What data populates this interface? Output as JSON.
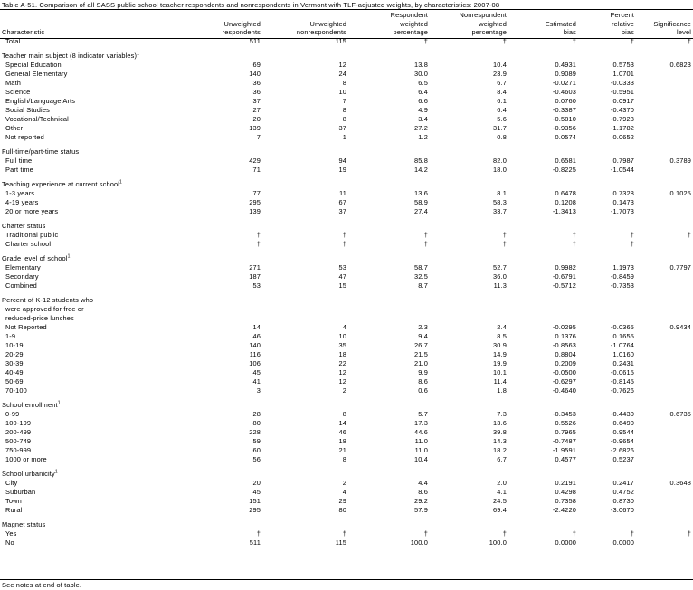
{
  "title": "Table A-51. Comparison of all SASS public school teacher respondents and nonrespondents in Vermont with TLF-adjusted weights, by characteristics: 2007-08",
  "columns": [
    [
      "Characteristic"
    ],
    [
      "Unweighted",
      "respondents"
    ],
    [
      "Unweighted",
      "nonrespondents"
    ],
    [
      "Respondent",
      "weighted",
      "percentage"
    ],
    [
      "Nonrespondent",
      "weighted",
      "percentage"
    ],
    [
      "Estimated",
      "bias"
    ],
    [
      "Percent",
      "relative",
      "bias"
    ],
    [
      "Significance",
      "level"
    ]
  ],
  "rows": [
    {
      "type": "row",
      "label": "Total",
      "indent": 1,
      "cells": [
        "511",
        "115",
        "†",
        "†",
        "†",
        "†",
        "†"
      ]
    },
    {
      "type": "gap"
    },
    {
      "type": "heading",
      "label": "Teacher main subject (8 indicator variables)",
      "sup": "1"
    },
    {
      "type": "row",
      "label": "Special Education",
      "indent": 1,
      "cells": [
        "69",
        "12",
        "13.8",
        "10.4",
        "0.4931",
        "0.5753",
        "0.6823"
      ]
    },
    {
      "type": "row",
      "label": "General Elementary",
      "indent": 1,
      "cells": [
        "140",
        "24",
        "30.0",
        "23.9",
        "0.9089",
        "1.0701",
        ""
      ]
    },
    {
      "type": "row",
      "label": "Math",
      "indent": 1,
      "cells": [
        "36",
        "8",
        "6.5",
        "6.7",
        "-0.0271",
        "-0.0333",
        ""
      ]
    },
    {
      "type": "row",
      "label": "Science",
      "indent": 1,
      "cells": [
        "36",
        "10",
        "6.4",
        "8.4",
        "-0.4603",
        "-0.5951",
        ""
      ]
    },
    {
      "type": "row",
      "label": "English/Language Arts",
      "indent": 1,
      "cells": [
        "37",
        "7",
        "6.6",
        "6.1",
        "0.0760",
        "0.0917",
        ""
      ]
    },
    {
      "type": "row",
      "label": "Social Studies",
      "indent": 1,
      "cells": [
        "27",
        "8",
        "4.9",
        "6.4",
        "-0.3387",
        "-0.4370",
        ""
      ]
    },
    {
      "type": "row",
      "label": "Vocational/Technical",
      "indent": 1,
      "cells": [
        "20",
        "8",
        "3.4",
        "5.6",
        "-0.5810",
        "-0.7923",
        ""
      ]
    },
    {
      "type": "row",
      "label": "Other",
      "indent": 1,
      "cells": [
        "139",
        "37",
        "27.2",
        "31.7",
        "-0.9356",
        "-1.1782",
        ""
      ]
    },
    {
      "type": "row",
      "label": "Not reported",
      "indent": 1,
      "cells": [
        "7",
        "1",
        "1.2",
        "0.8",
        "0.0574",
        "0.0652",
        ""
      ]
    },
    {
      "type": "gap"
    },
    {
      "type": "heading",
      "label": "Full-time/part-time status",
      "sup": ""
    },
    {
      "type": "row",
      "label": "Full time",
      "indent": 1,
      "cells": [
        "429",
        "94",
        "85.8",
        "82.0",
        "0.6581",
        "0.7987",
        "0.3789"
      ]
    },
    {
      "type": "row",
      "label": "Part time",
      "indent": 1,
      "cells": [
        "71",
        "19",
        "14.2",
        "18.0",
        "-0.8225",
        "-1.0544",
        ""
      ]
    },
    {
      "type": "gap"
    },
    {
      "type": "heading",
      "label": "Teaching experience at current school",
      "sup": "1"
    },
    {
      "type": "row",
      "label": "1-3 years",
      "indent": 1,
      "cells": [
        "77",
        "11",
        "13.6",
        "8.1",
        "0.6478",
        "0.7328",
        "0.1025"
      ]
    },
    {
      "type": "row",
      "label": "4-19 years",
      "indent": 1,
      "cells": [
        "295",
        "67",
        "58.9",
        "58.3",
        "0.1208",
        "0.1473",
        ""
      ]
    },
    {
      "type": "row",
      "label": "20 or more years",
      "indent": 1,
      "cells": [
        "139",
        "37",
        "27.4",
        "33.7",
        "-1.3413",
        "-1.7073",
        ""
      ]
    },
    {
      "type": "gap"
    },
    {
      "type": "heading",
      "label": "Charter status",
      "sup": ""
    },
    {
      "type": "row",
      "label": "Traditional public",
      "indent": 1,
      "cells": [
        "†",
        "†",
        "†",
        "†",
        "†",
        "†",
        "†"
      ]
    },
    {
      "type": "row",
      "label": "Charter school",
      "indent": 1,
      "cells": [
        "†",
        "†",
        "†",
        "†",
        "†",
        "†",
        ""
      ]
    },
    {
      "type": "gap"
    },
    {
      "type": "heading",
      "label": "Grade level of school",
      "sup": "1"
    },
    {
      "type": "row",
      "label": "Elementary",
      "indent": 1,
      "cells": [
        "271",
        "53",
        "58.7",
        "52.7",
        "0.9982",
        "1.1973",
        "0.7797"
      ]
    },
    {
      "type": "row",
      "label": "Secondary",
      "indent": 1,
      "cells": [
        "187",
        "47",
        "32.5",
        "36.0",
        "-0.6791",
        "-0.8459",
        ""
      ]
    },
    {
      "type": "row",
      "label": "Combined",
      "indent": 1,
      "cells": [
        "53",
        "15",
        "8.7",
        "11.3",
        "-0.5712",
        "-0.7353",
        ""
      ]
    },
    {
      "type": "gap"
    },
    {
      "type": "heading",
      "label": "Percent of K-12 students who",
      "sup": ""
    },
    {
      "type": "heading2",
      "label": "were approved for free or"
    },
    {
      "type": "heading2",
      "label": "reduced-price lunches"
    },
    {
      "type": "row",
      "label": "Not Reported",
      "indent": 1,
      "cells": [
        "14",
        "4",
        "2.3",
        "2.4",
        "-0.0295",
        "-0.0365",
        "0.9434"
      ]
    },
    {
      "type": "row",
      "label": "1-9",
      "indent": 1,
      "cells": [
        "46",
        "10",
        "9.4",
        "8.5",
        "0.1376",
        "0.1655",
        ""
      ]
    },
    {
      "type": "row",
      "label": "10-19",
      "indent": 1,
      "cells": [
        "140",
        "35",
        "26.7",
        "30.9",
        "-0.8563",
        "-1.0764",
        ""
      ]
    },
    {
      "type": "row",
      "label": "20-29",
      "indent": 1,
      "cells": [
        "116",
        "18",
        "21.5",
        "14.9",
        "0.8804",
        "1.0160",
        ""
      ]
    },
    {
      "type": "row",
      "label": "30-39",
      "indent": 1,
      "cells": [
        "106",
        "22",
        "21.0",
        "19.9",
        "0.2009",
        "0.2431",
        ""
      ]
    },
    {
      "type": "row",
      "label": "40-49",
      "indent": 1,
      "cells": [
        "45",
        "12",
        "9.9",
        "10.1",
        "-0.0500",
        "-0.0615",
        ""
      ]
    },
    {
      "type": "row",
      "label": "50-69",
      "indent": 1,
      "cells": [
        "41",
        "12",
        "8.6",
        "11.4",
        "-0.6297",
        "-0.8145",
        ""
      ]
    },
    {
      "type": "row",
      "label": "70-100",
      "indent": 1,
      "cells": [
        "3",
        "2",
        "0.6",
        "1.8",
        "-0.4640",
        "-0.7626",
        ""
      ]
    },
    {
      "type": "gap"
    },
    {
      "type": "heading",
      "label": "School enrollment",
      "sup": "1"
    },
    {
      "type": "row",
      "label": "0-99",
      "indent": 1,
      "cells": [
        "28",
        "8",
        "5.7",
        "7.3",
        "-0.3453",
        "-0.4430",
        "0.6735"
      ]
    },
    {
      "type": "row",
      "label": "100-199",
      "indent": 1,
      "cells": [
        "80",
        "14",
        "17.3",
        "13.6",
        "0.5526",
        "0.6490",
        ""
      ]
    },
    {
      "type": "row",
      "label": "200-499",
      "indent": 1,
      "cells": [
        "228",
        "46",
        "44.6",
        "39.8",
        "0.7965",
        "0.9544",
        ""
      ]
    },
    {
      "type": "row",
      "label": "500-749",
      "indent": 1,
      "cells": [
        "59",
        "18",
        "11.0",
        "14.3",
        "-0.7487",
        "-0.9654",
        ""
      ]
    },
    {
      "type": "row",
      "label": "750-999",
      "indent": 1,
      "cells": [
        "60",
        "21",
        "11.0",
        "18.2",
        "-1.9591",
        "-2.6826",
        ""
      ]
    },
    {
      "type": "row",
      "label": "1000 or more",
      "indent": 1,
      "cells": [
        "56",
        "8",
        "10.4",
        "6.7",
        "0.4577",
        "0.5237",
        ""
      ]
    },
    {
      "type": "gap"
    },
    {
      "type": "heading",
      "label": "School urbanicity",
      "sup": "1"
    },
    {
      "type": "row",
      "label": "City",
      "indent": 1,
      "cells": [
        "20",
        "2",
        "4.4",
        "2.0",
        "0.2191",
        "0.2417",
        "0.3648"
      ]
    },
    {
      "type": "row",
      "label": "Suburban",
      "indent": 1,
      "cells": [
        "45",
        "4",
        "8.6",
        "4.1",
        "0.4298",
        "0.4752",
        ""
      ]
    },
    {
      "type": "row",
      "label": "Town",
      "indent": 1,
      "cells": [
        "151",
        "29",
        "29.2",
        "24.5",
        "0.7358",
        "0.8730",
        ""
      ]
    },
    {
      "type": "row",
      "label": "Rural",
      "indent": 1,
      "cells": [
        "295",
        "80",
        "57.9",
        "69.4",
        "-2.4220",
        "-3.0670",
        ""
      ]
    },
    {
      "type": "gap"
    },
    {
      "type": "heading",
      "label": "Magnet status",
      "sup": ""
    },
    {
      "type": "row",
      "label": "Yes",
      "indent": 1,
      "cells": [
        "†",
        "†",
        "†",
        "†",
        "†",
        "†",
        "†"
      ]
    },
    {
      "type": "row",
      "label": "No",
      "indent": 1,
      "cells": [
        "511",
        "115",
        "100.0",
        "100.0",
        "0.0000",
        "0.0000",
        ""
      ]
    }
  ],
  "footnote": "See notes at end of table."
}
